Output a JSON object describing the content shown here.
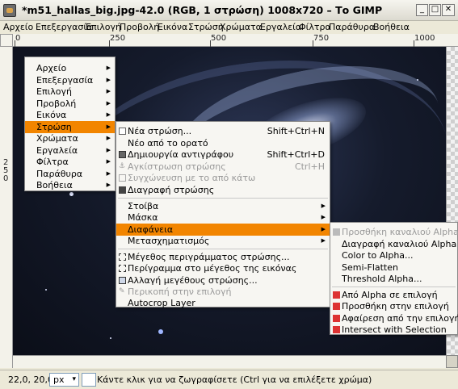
{
  "window": {
    "title": "*m51_hallas_big.jpg-42.0 (RGB, 1 στρώση) 1008x720 – Το GIMP",
    "minimize": "_",
    "maximize": "□",
    "close": "✕"
  },
  "menubar": [
    "Αρχείο",
    "Επεξεργασία",
    "Επιλογή",
    "Προβολή",
    "Εικόνα",
    "Στρώση",
    "Χρώματα",
    "Εργαλεία",
    "Φίλτρα",
    "Παράθυρα",
    "Βοήθεια"
  ],
  "rulers": {
    "h_labels": [
      "0",
      "250",
      "500",
      "750",
      "1000"
    ],
    "v_labels": [
      "2",
      "5",
      "0"
    ]
  },
  "image_menu": {
    "items": [
      "Αρχείο",
      "Επεξεργασία",
      "Επιλογή",
      "Προβολή",
      "Εικόνα",
      "Στρώση",
      "Χρώματα",
      "Εργαλεία",
      "Φίλτρα",
      "Παράθυρα",
      "Βοήθεια"
    ],
    "active": "Στρώση"
  },
  "layer_menu": {
    "items": [
      {
        "label": "Νέα στρώση...",
        "shortcut": "Shift+Ctrl+N",
        "icon": "new-layer-icon"
      },
      {
        "label": "Νέο από το ορατό",
        "shortcut": ""
      },
      {
        "label": "Δημιουργία αντιγράφου",
        "shortcut": "Shift+Ctrl+D",
        "icon": "duplicate-icon"
      },
      {
        "label": "Αγκίστρωση στρώσης",
        "shortcut": "Ctrl+H",
        "disabled": true,
        "icon": "anchor-icon"
      },
      {
        "label": "Συγχώνευση με το από κάτω",
        "shortcut": "",
        "disabled": true,
        "icon": "merge-icon"
      },
      {
        "label": "Διαγραφή στρώσης",
        "shortcut": "",
        "icon": "delete-icon"
      },
      {
        "label": "Στοίβα",
        "submenu": true
      },
      {
        "label": "Μάσκα",
        "submenu": true
      },
      {
        "label": "Διαφάνεια",
        "submenu": true,
        "active": true
      },
      {
        "label": "Μετασχηματισμός",
        "submenu": true
      },
      {
        "label": "Μέγεθος περιγράμματος στρώσης...",
        "icon": "resize-icon"
      },
      {
        "label": "Περίγραμμα στο μέγεθος της εικόνας",
        "icon": "fit-icon"
      },
      {
        "label": "Αλλαγή μεγέθους στρώσης...",
        "icon": "scale-icon"
      },
      {
        "label": "Περικοπή στην επιλογή",
        "disabled": true,
        "icon": "crop-icon"
      },
      {
        "label": "Autocrop Layer"
      }
    ]
  },
  "transparency_menu": {
    "items": [
      {
        "label": "Προσθήκη καναλιού Alpha",
        "disabled": true,
        "icon": "add-alpha-icon"
      },
      {
        "label": "Διαγραφή καναλιού Alpha"
      },
      {
        "label": "Color to Alpha..."
      },
      {
        "label": "Semi-Flatten"
      },
      {
        "label": "Threshold Alpha..."
      },
      {
        "label": "Από Alpha σε επιλογή",
        "icon": "alpha-to-selection-icon"
      },
      {
        "label": "Προσθήκη στην επιλογή",
        "icon": "add-selection-icon"
      },
      {
        "label": "Αφαίρεση από την επιλογή",
        "icon": "subtract-selection-icon"
      },
      {
        "label": "Intersect with Selection",
        "icon": "intersect-selection-icon"
      }
    ]
  },
  "status": {
    "coords": "22,0, 20,0",
    "unit": "px",
    "message": "Κάντε κλικ για να ζωγραφίσετε (Ctrl για να επιλέξετε χρώμα)"
  },
  "colors": {
    "menu_highlight": "#f28500",
    "chrome": "#ece9d8"
  }
}
